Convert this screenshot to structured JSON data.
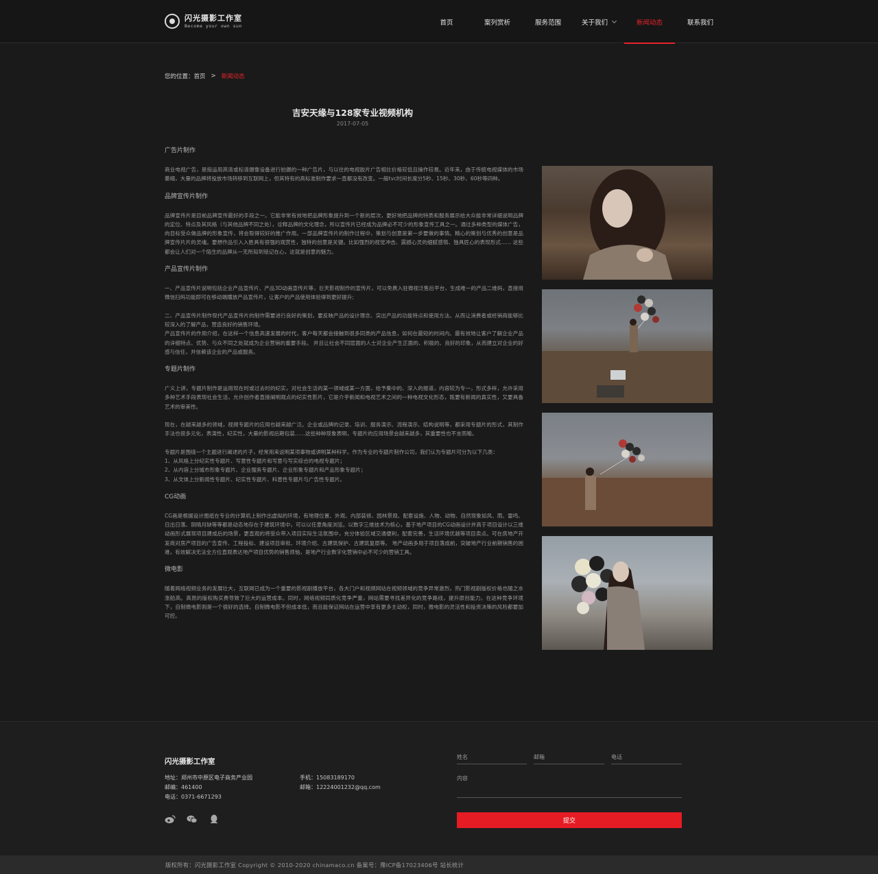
{
  "header": {
    "logo_cn": "闪光摄影工作室",
    "logo_en": "Become your own sun",
    "nav": [
      "首页",
      "案列赏析",
      "服务范围",
      "关于我们",
      "新闻动态",
      "联系我们"
    ],
    "active_nav": "新闻动态"
  },
  "breadcrumb": {
    "label": "您的位置：",
    "home": "首页",
    "sep": ">",
    "current": "新闻动态"
  },
  "article": {
    "title": "吉安天缘与128家专业视频机构",
    "date": "2017-07-05",
    "sections": [
      {
        "heading": "广告片制作",
        "paras": [
          "商业电视广告，是指运用高清或标清摄像设备进行拍摄的一种广告片，与以往的电视胶片广告相比价格较低且操作较易。近年来，由于传统电视媒体的市场萎缩，大量的品牌将投放市场转移到互联网上，但其特有的高标准制作要求一直都没有改变。一般tvc时间长度分5秒、15秒、30秒、60秒等四种。"
        ]
      },
      {
        "heading": "品牌宣传片制作",
        "paras": [
          "品牌宣传片是目前品牌宣传最好的手段之一。它能非常有效地把品牌形象提升到一个新的层次，更好地把品牌的特质和服务展示给大众能非常详细说明品牌的定位、特点及其风格（与其他品牌不同之处），诠释品牌的文化理念，所以宣传片已经成为品牌必不可少的形象宣传工具之一。通过多种类型的媒体广告，向目标受众做品牌的形象宣传，将会取得较好的推广作用。一部品牌宣传片的制作过程中，策划与创意是第一步要做的事情。精心的策划与优秀的创意是品牌宣传片片的灵魂。要想作品引入入胜具有很强的观赏性，独特的创意是关键。比如强烈的视觉冲击、震撼心灵的细腻感情、独具匠心的表现形式…… 这些都会让人们对一个陌生的品牌从一无所知到铭记在心，这就是创意的魅力。"
        ]
      },
      {
        "heading": "产品宣传片制作",
        "paras": [
          "一、产品宣传片说明包括企业产品宣传片、产品3D动画宣传片等，巨天影视制作的宣传片，可以免费入驻微视泛售后平台，生成唯一的产品二维码，直接用微信扫码功能即可在移动端播放产品宣传片，让客户的产品使用体验得到更好提升;",
          "二、产品宣传片制作现代产品宣传片的制作需要进行良好的策划，要反映产品的设计理念、突出产品的功能特点和使用方法。从而让消费者或经销商能够比较深入的了解产品，营造良好的销售环境。\n产品宣传片的作用介绍，在这样一个信息高速发展的时代，客户每天都会接触到很多同类的产品信息，如何在最短的时间内、最有效地让客户了解企业产品的详细特点、优势、与众不同之处就成为企业营销的重要手段。    并且让社会不同层面的人士对企业产生正面的、积极的、良好的印象，从而建立对企业的好感与信任，并信赖该企业的产品或服务。"
        ]
      },
      {
        "heading": "专题片制作",
        "paras": [
          "广义上讲，专题片制作是运用现在时或过去时的纪实，对社会生活的某一领域或某一方面，给予集中的、深入的报道，内容较为专一，形式多样，允许采用多种艺术手段表现社会生活，允许创作者直接阐明观点的纪实性影片，它是介乎新闻和电视艺术之间的一种电视文化形态，既要有新闻的真实性，又要具备艺术的审美性。",
          "现在，在越来越多的领域，视频专题片的应用也越来越广泛。企业或品牌的记录、培训、服务演示、流程演示、结构说明等，都采用专题片的形式，其制作手法也很多元化，表演性，纪实性，大量的影视后期包装……这些种种现象表明，专题片的应用场景会越来越多，其重要性也不言而喻。",
          "专题片是围绕一个主题进行阐述的片子，经常用来说明某项事物或讲明某种科学。作为专业的专题片制作公司，我们认为专题片可分为以下几类：\n1、从风格上分纪实性专题片、写意性专题片和写意与写实综合的电视专题片；\n2、从内容上分城市形象专题片、企业服务专题片、企业形象专题片和产品形象专题片；\n3、从文体上分新闻性专题片、纪实性专题片、科普性专题片与广告性专题片。"
        ]
      },
      {
        "heading": "CG动画",
        "paras": [
          "CG画是根据设计图纸在专业的计算机上制作出虚拟的环境，有地理位置、外观、内部装修、园林景观、配套设施、人物、动物、自然现象如风、雨、雷鸣、日出日落、阴晴月缺等等都是动态地存在于建筑环境中，可以以任意角度浏览。以数字三维技术为核心，基于地产项目的CG动画设计并高于项目设计以三维动画形式展现项目建成后的场景，更直观的将受众带入项目实际生活氛围中，充分体验区域交通便利，配套完善，生活环境优越等项目卖点。可在房地产开发商对房产项目的广告宣传、工程投标、建设项目审批、环境介绍、古建筑保护、古建筑复原等。     地产动画多用于项目落成前，突破地产行业前期销售的困难，有效解决无法全方位直观表达地产项目优势的销售烦恼，是地产行业数字化营销中必不可少的营销工具。"
        ]
      },
      {
        "heading": "微电影",
        "paras": [
          "随着网络视频业务的发展壮大，互联网已成为一个重要的影视剧播放平台，各大门户和视频网站在视频领域的竞争异常激烈，热门影视剧版权价格也随之水涨船高。高昂的版权购买费导致了巨大的运营成本。同时，网络视频同质化竞争严重，网站需要寻找差异化的竞争路线，提升原创能力。在这种竞争环境下，自制微电影则是一个很好的选择。自制微电影不但成本低，而且能保证网站在运营中享有更多主动权，同时，微电影的灵活性和投资决策的风险都要加可控。"
        ]
      }
    ]
  },
  "footer": {
    "name": "闪光摄影工作室",
    "address": "地址：郑州市中原区电子商务产业园",
    "postcode": "邮编：461400",
    "phone": "电话：0371-6671293",
    "mobile": "手机：15083189170",
    "email": "邮箱：12224001232@qq.com",
    "form": {
      "name_label": "姓名",
      "email_label": "邮箱",
      "phone_label": "电话",
      "content_label": "内容",
      "submit_label": "提交"
    },
    "social_icons": [
      "weibo-icon",
      "wechat-icon",
      "qq-icon"
    ]
  },
  "copyright": "版权所有：闪光摄影工作室  Copyright © 2010-2020 chinamaco.cn  备案号：豫ICP备17023406号  站长统计",
  "colors": {
    "accent": "#e8242b",
    "bg": "#1a1a1a",
    "header_bg": "#161616"
  }
}
